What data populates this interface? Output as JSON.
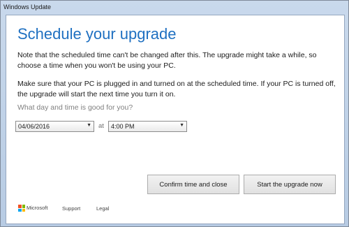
{
  "window": {
    "title": "Windows Update"
  },
  "main": {
    "heading": "Schedule your upgrade",
    "paragraph_1": "Note that the scheduled time can't be changed after this. The upgrade might take a while, so choose a time when you won't be using your PC.",
    "paragraph_2": "Make sure that your PC is plugged in and turned on at the scheduled time. If your PC is turned off, the upgrade will start the next time you turn it on.",
    "question": "What day and time is good for you?",
    "date_value": "04/06/2016",
    "at_label": "at",
    "time_value": "4:00 PM",
    "dropdown_icon": "chevron-down-icon"
  },
  "buttons": {
    "confirm_label": "Confirm time and close",
    "start_label": "Start the upgrade now"
  },
  "footer": {
    "brand": "Microsoft",
    "support": "Support",
    "legal": "Legal"
  },
  "colors": {
    "heading": "#1f70c1",
    "question": "#808080",
    "titlebar": "#c9d9ec"
  }
}
